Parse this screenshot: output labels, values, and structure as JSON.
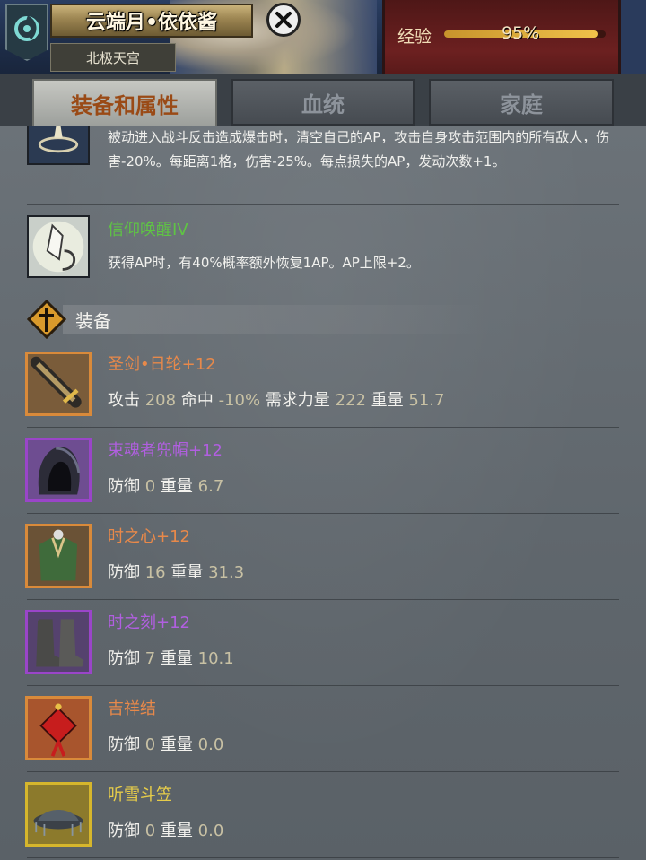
{
  "header": {
    "character_name": "云端月•依依酱",
    "location": "北极天宫",
    "xp_label": "经验",
    "xp_value": "95%",
    "xp_fraction": 0.95
  },
  "tabs": [
    {
      "label": "装备和属性",
      "active": true
    },
    {
      "label": "血统",
      "active": false
    },
    {
      "label": "家庭",
      "active": false
    }
  ],
  "skills": [
    {
      "name": "",
      "description": "被动进入战斗反击造成爆击时，清空自己的AP，攻击自身攻击范围内的所有敌人，伤害-20%。每距离1格，伤害-25%。每点损失的AP，发动次数+1。",
      "icon": "passive-skill-icon"
    },
    {
      "name": "信仰唤醒IV",
      "description": "获得AP时，有40%概率额外恢复1AP。AP上限+2。",
      "icon": "faith-crystal-icon"
    }
  ],
  "equipment_section": {
    "title": "装备",
    "icon": "cross-emblem-icon"
  },
  "equipment": [
    {
      "name": "圣剑•日轮",
      "level": "+12",
      "name_color": "#e8894a",
      "frame_color": "#d98a3a",
      "icon": "sword-icon",
      "stats": [
        {
          "label": "攻击",
          "value": "208"
        },
        {
          "label": "命中",
          "value": "-10%"
        },
        {
          "label": "需求力量",
          "value": "222"
        },
        {
          "label": "重量",
          "value": "51.7"
        }
      ]
    },
    {
      "name": "束魂者兜帽",
      "level": "+12",
      "name_color": "#b15fe0",
      "frame_color": "#9a45c9",
      "icon": "hood-icon",
      "stats": [
        {
          "label": "防御",
          "value": "0"
        },
        {
          "label": "重量",
          "value": "6.7"
        }
      ]
    },
    {
      "name": "时之心",
      "level": "+12",
      "name_color": "#e8894a",
      "frame_color": "#d98a3a",
      "icon": "armor-icon",
      "stats": [
        {
          "label": "防御",
          "value": "16"
        },
        {
          "label": "重量",
          "value": "31.3"
        }
      ]
    },
    {
      "name": "时之刻",
      "level": "+12",
      "name_color": "#b15fe0",
      "frame_color": "#9a45c9",
      "icon": "boots-icon",
      "stats": [
        {
          "label": "防御",
          "value": "7"
        },
        {
          "label": "重量",
          "value": "10.1"
        }
      ]
    },
    {
      "name": "吉祥结",
      "level": "",
      "name_color": "#e8894a",
      "frame_color": "#d98a3a",
      "icon": "chinese-knot-icon",
      "stats": [
        {
          "label": "防御",
          "value": "0"
        },
        {
          "label": "重量",
          "value": "0.0"
        }
      ]
    },
    {
      "name": "听雪斗笠",
      "level": "",
      "name_color": "#e6cc4a",
      "frame_color": "#d6b62c",
      "icon": "bamboo-hat-icon",
      "stats": [
        {
          "label": "防御",
          "value": "0"
        },
        {
          "label": "重量",
          "value": "0.0"
        }
      ]
    }
  ]
}
